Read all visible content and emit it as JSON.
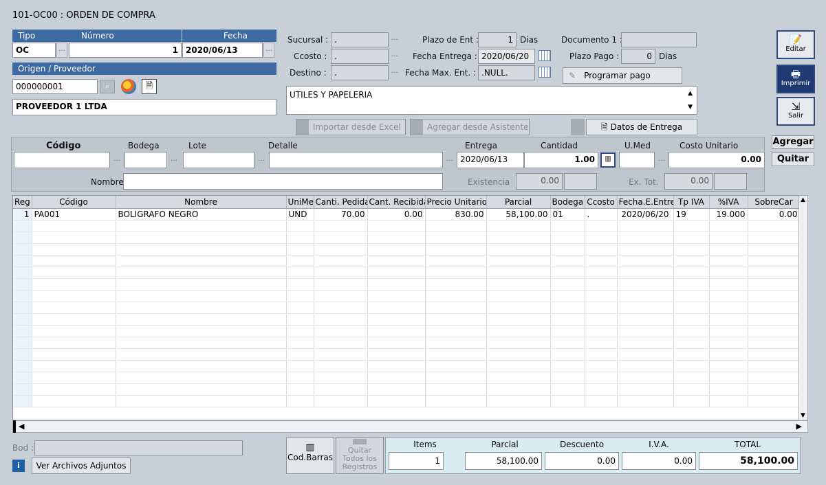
{
  "window": {
    "title": "101-OC00 : ORDEN DE COMPRA"
  },
  "header": {
    "tipo_label": "Tipo",
    "numero_label": "Número",
    "fecha_label": "Fecha",
    "tipo_value": "OC",
    "numero_value": "1",
    "fecha_value": "2020/06/13",
    "origen_label": "Origen / Proveedor",
    "proveedor_code": "000000001",
    "proveedor_name": "PROVEEDOR 1 LTDA"
  },
  "info": {
    "sucursal_label": "Sucursal :",
    "sucursal_value": ".",
    "ccosto_label": "Ccosto :",
    "ccosto_value": ".",
    "destino_label": "Destino :",
    "destino_value": ".",
    "plazo_ent_label": "Plazo de Ent :",
    "plazo_ent_value": "1",
    "plazo_ent_unit": "Dias",
    "fecha_entrega_label": "Fecha Entrega :",
    "fecha_entrega_value": "2020/06/20",
    "fecha_max_label": "Fecha Max. Ent. :",
    "fecha_max_value": ".NULL.",
    "documento_label": "Documento 1 :",
    "documento_value": "",
    "plazo_pago_label": "Plazo Pago :",
    "plazo_pago_value": "0",
    "plazo_pago_unit": "Dias",
    "programar_pago": "Programar pago",
    "observaciones": "UTILES Y PAPELERIA"
  },
  "actions": {
    "importar_excel": "Importar desde Excel",
    "agregar_asistente": "Agregar desde Asistente",
    "datos_entrega": "Datos de Entrega"
  },
  "side_buttons": {
    "editar": "Editar",
    "imprimir": "Imprimir",
    "salir": "Salir"
  },
  "entry": {
    "codigo_label": "Código",
    "bodega_label": "Bodega",
    "lote_label": "Lote",
    "detalle_label": "Detalle",
    "entrega_label": "Entrega",
    "cantidad_label": "Cantidad",
    "umed_label": "U.Med",
    "costo_label": "Costo Unitario",
    "entrega_value": "2020/06/13",
    "cantidad_value": "1.00",
    "costo_value": "0.00",
    "nombre_label": "Nombre",
    "existencia_label": "Existencia",
    "existencia_value": "0.00",
    "extot_label": "Ex. Tot.",
    "extot_value": "0.00",
    "agregar": "Agregar",
    "quitar": "Quitar"
  },
  "grid": {
    "columns": [
      "Reg",
      "Código",
      "Nombre",
      "UniMed",
      "Canti. Pedida",
      "Cant. Recibida",
      "Precio Unitario",
      "Parcial",
      "Bodega",
      "Ccosto",
      "Fecha.E.Entre",
      "Tp IVA",
      "%IVA",
      "SobreCar"
    ],
    "rows": [
      [
        "1",
        "PA001",
        "BOLIGRAFO NEGRO",
        "UND",
        "70.00",
        "0.00",
        "830.00",
        "58,100.00",
        "01",
        ".",
        "2020/06/20",
        "19",
        "19.000",
        "0.00"
      ]
    ]
  },
  "footer": {
    "bod_label": "Bod :",
    "ver_adjuntos": "Ver Archivos Adjuntos",
    "cod_barras": "Cod.Barras",
    "quitar_todos": "Quitar Todos los Registros",
    "items_label": "Items",
    "items_value": "1",
    "parcial_label": "Parcial",
    "parcial_value": "58,100.00",
    "descuento_label": "Descuento",
    "descuento_value": "0.00",
    "iva_label": "I.V.A.",
    "iva_value": "0.00",
    "total_label": "TOTAL",
    "total_value": "58,100.00"
  }
}
